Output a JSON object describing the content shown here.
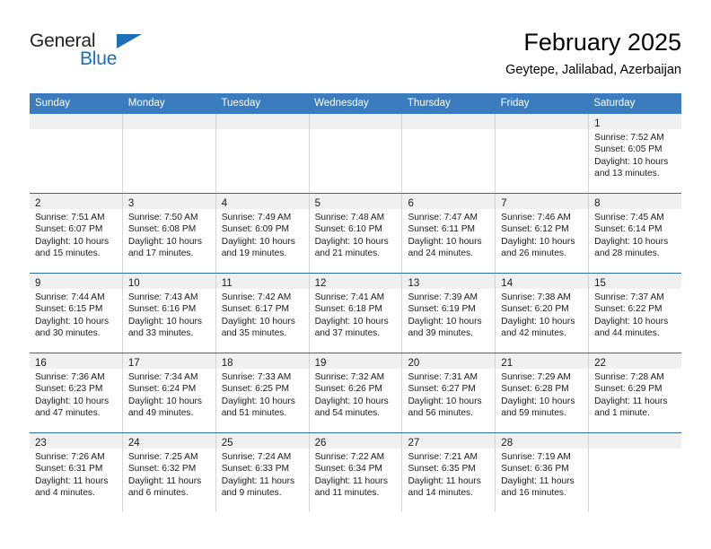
{
  "brand": {
    "name_part1": "General",
    "name_part2": "Blue",
    "triangle_icon": "triangle-icon",
    "color_primary": "#1d6fb8",
    "color_text": "#231f20"
  },
  "header": {
    "title": "February 2025",
    "subtitle": "Geytepe, Jalilabad, Azerbaijan"
  },
  "calendar": {
    "accent_color": "#3a7cbe",
    "weekdays": [
      "Sunday",
      "Monday",
      "Tuesday",
      "Wednesday",
      "Thursday",
      "Friday",
      "Saturday"
    ],
    "weeks": [
      [
        {
          "day": "",
          "lines": []
        },
        {
          "day": "",
          "lines": []
        },
        {
          "day": "",
          "lines": []
        },
        {
          "day": "",
          "lines": []
        },
        {
          "day": "",
          "lines": []
        },
        {
          "day": "",
          "lines": []
        },
        {
          "day": "1",
          "lines": [
            "Sunrise: 7:52 AM",
            "Sunset: 6:05 PM",
            "Daylight: 10 hours",
            "and 13 minutes."
          ]
        }
      ],
      [
        {
          "day": "2",
          "lines": [
            "Sunrise: 7:51 AM",
            "Sunset: 6:07 PM",
            "Daylight: 10 hours",
            "and 15 minutes."
          ]
        },
        {
          "day": "3",
          "lines": [
            "Sunrise: 7:50 AM",
            "Sunset: 6:08 PM",
            "Daylight: 10 hours",
            "and 17 minutes."
          ]
        },
        {
          "day": "4",
          "lines": [
            "Sunrise: 7:49 AM",
            "Sunset: 6:09 PM",
            "Daylight: 10 hours",
            "and 19 minutes."
          ]
        },
        {
          "day": "5",
          "lines": [
            "Sunrise: 7:48 AM",
            "Sunset: 6:10 PM",
            "Daylight: 10 hours",
            "and 21 minutes."
          ]
        },
        {
          "day": "6",
          "lines": [
            "Sunrise: 7:47 AM",
            "Sunset: 6:11 PM",
            "Daylight: 10 hours",
            "and 24 minutes."
          ]
        },
        {
          "day": "7",
          "lines": [
            "Sunrise: 7:46 AM",
            "Sunset: 6:12 PM",
            "Daylight: 10 hours",
            "and 26 minutes."
          ]
        },
        {
          "day": "8",
          "lines": [
            "Sunrise: 7:45 AM",
            "Sunset: 6:14 PM",
            "Daylight: 10 hours",
            "and 28 minutes."
          ]
        }
      ],
      [
        {
          "day": "9",
          "lines": [
            "Sunrise: 7:44 AM",
            "Sunset: 6:15 PM",
            "Daylight: 10 hours",
            "and 30 minutes."
          ]
        },
        {
          "day": "10",
          "lines": [
            "Sunrise: 7:43 AM",
            "Sunset: 6:16 PM",
            "Daylight: 10 hours",
            "and 33 minutes."
          ]
        },
        {
          "day": "11",
          "lines": [
            "Sunrise: 7:42 AM",
            "Sunset: 6:17 PM",
            "Daylight: 10 hours",
            "and 35 minutes."
          ]
        },
        {
          "day": "12",
          "lines": [
            "Sunrise: 7:41 AM",
            "Sunset: 6:18 PM",
            "Daylight: 10 hours",
            "and 37 minutes."
          ]
        },
        {
          "day": "13",
          "lines": [
            "Sunrise: 7:39 AM",
            "Sunset: 6:19 PM",
            "Daylight: 10 hours",
            "and 39 minutes."
          ]
        },
        {
          "day": "14",
          "lines": [
            "Sunrise: 7:38 AM",
            "Sunset: 6:20 PM",
            "Daylight: 10 hours",
            "and 42 minutes."
          ]
        },
        {
          "day": "15",
          "lines": [
            "Sunrise: 7:37 AM",
            "Sunset: 6:22 PM",
            "Daylight: 10 hours",
            "and 44 minutes."
          ]
        }
      ],
      [
        {
          "day": "16",
          "lines": [
            "Sunrise: 7:36 AM",
            "Sunset: 6:23 PM",
            "Daylight: 10 hours",
            "and 47 minutes."
          ]
        },
        {
          "day": "17",
          "lines": [
            "Sunrise: 7:34 AM",
            "Sunset: 6:24 PM",
            "Daylight: 10 hours",
            "and 49 minutes."
          ]
        },
        {
          "day": "18",
          "lines": [
            "Sunrise: 7:33 AM",
            "Sunset: 6:25 PM",
            "Daylight: 10 hours",
            "and 51 minutes."
          ]
        },
        {
          "day": "19",
          "lines": [
            "Sunrise: 7:32 AM",
            "Sunset: 6:26 PM",
            "Daylight: 10 hours",
            "and 54 minutes."
          ]
        },
        {
          "day": "20",
          "lines": [
            "Sunrise: 7:31 AM",
            "Sunset: 6:27 PM",
            "Daylight: 10 hours",
            "and 56 minutes."
          ]
        },
        {
          "day": "21",
          "lines": [
            "Sunrise: 7:29 AM",
            "Sunset: 6:28 PM",
            "Daylight: 10 hours",
            "and 59 minutes."
          ]
        },
        {
          "day": "22",
          "lines": [
            "Sunrise: 7:28 AM",
            "Sunset: 6:29 PM",
            "Daylight: 11 hours",
            "and 1 minute."
          ]
        }
      ],
      [
        {
          "day": "23",
          "lines": [
            "Sunrise: 7:26 AM",
            "Sunset: 6:31 PM",
            "Daylight: 11 hours",
            "and 4 minutes."
          ]
        },
        {
          "day": "24",
          "lines": [
            "Sunrise: 7:25 AM",
            "Sunset: 6:32 PM",
            "Daylight: 11 hours",
            "and 6 minutes."
          ]
        },
        {
          "day": "25",
          "lines": [
            "Sunrise: 7:24 AM",
            "Sunset: 6:33 PM",
            "Daylight: 11 hours",
            "and 9 minutes."
          ]
        },
        {
          "day": "26",
          "lines": [
            "Sunrise: 7:22 AM",
            "Sunset: 6:34 PM",
            "Daylight: 11 hours",
            "and 11 minutes."
          ]
        },
        {
          "day": "27",
          "lines": [
            "Sunrise: 7:21 AM",
            "Sunset: 6:35 PM",
            "Daylight: 11 hours",
            "and 14 minutes."
          ]
        },
        {
          "day": "28",
          "lines": [
            "Sunrise: 7:19 AM",
            "Sunset: 6:36 PM",
            "Daylight: 11 hours",
            "and 16 minutes."
          ]
        },
        {
          "day": "",
          "lines": []
        }
      ]
    ]
  }
}
